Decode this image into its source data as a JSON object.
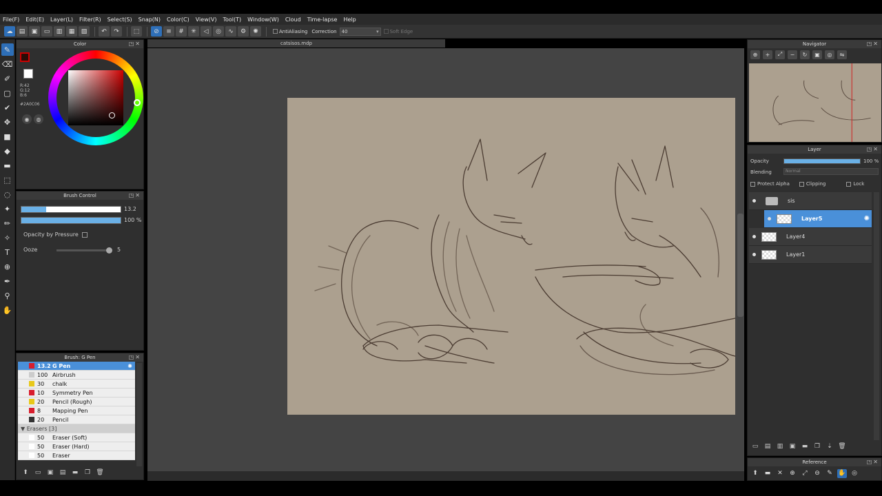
{
  "menu": [
    "File(F)",
    "Edit(E)",
    "Layer(L)",
    "Filter(R)",
    "Select(S)",
    "Snap(N)",
    "Color(C)",
    "View(V)",
    "Tool(T)",
    "Window(W)",
    "Cloud",
    "Time-lapse",
    "Help"
  ],
  "toolbar": {
    "antialiasing_label": "AntiAliasing",
    "correction_label": "Correction",
    "correction_value": "40",
    "soft_edge_label": "Soft Edge"
  },
  "color_panel": {
    "title": "Color",
    "r": "R:42",
    "g": "G:12",
    "b": "B:6",
    "hex": "#2A0C06",
    "fg_color": "#2a0c06"
  },
  "brush_control": {
    "title": "Brush Control",
    "size_value": "13.2",
    "size_fraction": 0.25,
    "opacity_value": "100 %",
    "opacity_fraction": 1.0,
    "opacity_by_pressure_label": "Opacity by Pressure",
    "ooze_label": "Ooze",
    "ooze_value": "5"
  },
  "brush_panel": {
    "title": "Brush: G Pen",
    "brushes": [
      {
        "size": "13.2",
        "name": "G Pen",
        "color": "#d81e2e",
        "selected": true
      },
      {
        "size": "100",
        "name": "Airbrush",
        "color": "#cccccc"
      },
      {
        "size": "30",
        "name": "chalk",
        "color": "#e8c81a"
      },
      {
        "size": "10",
        "name": "Symmetry Pen",
        "color": "#d81e2e"
      },
      {
        "size": "20",
        "name": "Pencil (Rough)",
        "color": "#e8c81a"
      },
      {
        "size": "8",
        "name": "Mapping Pen",
        "color": "#d81e2e"
      },
      {
        "size": "20",
        "name": "Pencil",
        "color": "#333333"
      }
    ],
    "group_label": "Erasers [3]",
    "erasers": [
      {
        "size": "50",
        "name": "Eraser (Soft)",
        "color": "#ffffff"
      },
      {
        "size": "50",
        "name": "Eraser (Hard)",
        "color": "#ffffff"
      },
      {
        "size": "50",
        "name": "Eraser",
        "color": "#ffffff"
      }
    ]
  },
  "document": {
    "tab_title": "catsisos.mdp"
  },
  "navigator": {
    "title": "Navigator"
  },
  "layer_panel": {
    "title": "Layer",
    "opacity_label": "Opacity",
    "opacity_value": "100 %",
    "blending_label": "Blending",
    "blending_value": "Normal",
    "protect_alpha_label": "Protect Alpha",
    "clipping_label": "Clipping",
    "lock_label": "Lock",
    "layers": [
      {
        "name": "sis",
        "type": "folder"
      },
      {
        "name": "Layer5",
        "type": "layer",
        "selected": true
      },
      {
        "name": "Layer4",
        "type": "layer"
      },
      {
        "name": "Layer1",
        "type": "layer"
      }
    ]
  },
  "reference": {
    "title": "Reference"
  }
}
